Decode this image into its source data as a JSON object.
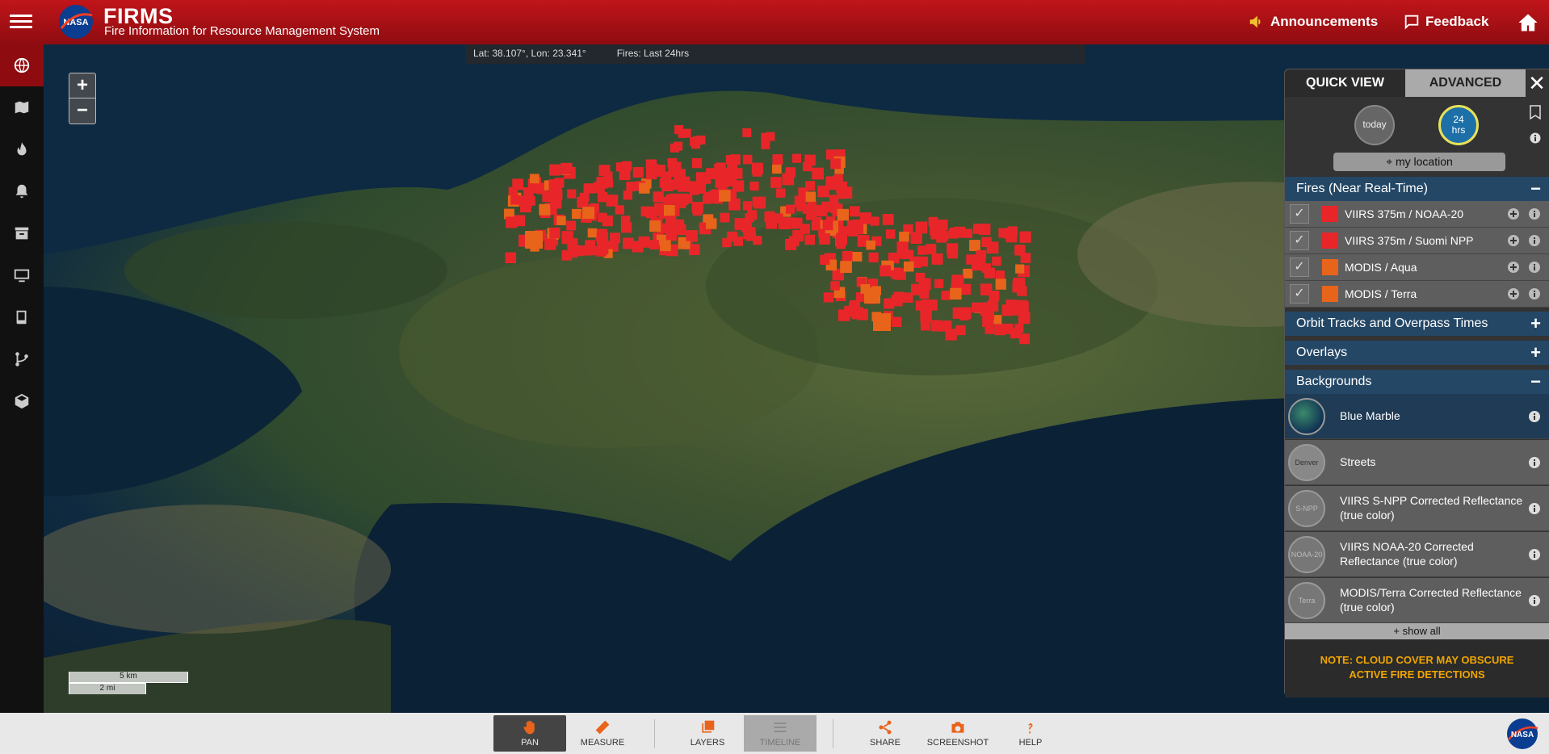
{
  "header": {
    "brand_title": "FIRMS",
    "brand_subtitle": "Fire Information for Resource Management System",
    "announcements": "Announcements",
    "feedback": "Feedback",
    "logo_text": "NASA"
  },
  "sidebar": {
    "items": [
      {
        "icon": "globe-icon",
        "active": true
      },
      {
        "icon": "map-icon",
        "active": false
      },
      {
        "icon": "fire-icon",
        "active": false
      },
      {
        "icon": "bell-icon",
        "active": false
      },
      {
        "icon": "archive-icon",
        "active": false
      },
      {
        "icon": "monitor-icon",
        "active": false
      },
      {
        "icon": "book-icon",
        "active": false
      },
      {
        "icon": "fork-icon",
        "active": false
      },
      {
        "icon": "cube-icon",
        "active": false
      }
    ]
  },
  "map": {
    "coord_text": "Lat: 38.107°, Lon: 23.341°",
    "fires_text": "Fires: Last 24hrs",
    "zoom_in": "+",
    "zoom_out": "−",
    "scale_km": "5 km",
    "scale_mi": "2 mi"
  },
  "toolbar": {
    "pan": "PAN",
    "measure": "MEASURE",
    "layers": "LAYERS",
    "timeline": "TIMELINE",
    "share": "SHARE",
    "screenshot": "SCREENSHOT",
    "help": "HELP"
  },
  "panel": {
    "tab_quick": "QUICK VIEW",
    "tab_advanced": "ADVANCED",
    "today": "today",
    "hrs_top": "24",
    "hrs_bottom": "hrs",
    "my_location": "my location",
    "sections": {
      "fires": "Fires (Near Real-Time)",
      "orbit": "Orbit Tracks and Overpass Times",
      "overlays": "Overlays",
      "backgrounds": "Backgrounds"
    },
    "fire_layers": [
      {
        "label": "VIIRS 375m / NOAA-20",
        "color": "#e8262a"
      },
      {
        "label": "VIIRS 375m / Suomi NPP",
        "color": "#e8262a"
      },
      {
        "label": "MODIS / Aqua",
        "color": "#e8641a"
      },
      {
        "label": "MODIS / Terra",
        "color": "#e8641a"
      }
    ],
    "backgrounds": [
      {
        "label": "Blue Marble",
        "selected": true
      },
      {
        "label": "Streets",
        "selected": false,
        "thumb_text": "Denver"
      },
      {
        "label": "VIIRS S-NPP Corrected Reflectance (true color)",
        "selected": false,
        "thumb_text": "S-NPP"
      },
      {
        "label": "VIIRS NOAA-20 Corrected Reflectance (true color)",
        "selected": false,
        "thumb_text": "NOAA-20"
      },
      {
        "label": "MODIS/Terra Corrected Reflectance (true color)",
        "selected": false,
        "thumb_text": "Terra"
      }
    ],
    "show_all": "+ show all",
    "note": "NOTE: CLOUD COVER MAY OBSCURE ACTIVE FIRE DETECTIONS"
  },
  "colors": {
    "header": "#c0151a",
    "viirs": "#e8262a",
    "modis": "#e8641a",
    "section": "#244766",
    "note": "#f0a500"
  }
}
